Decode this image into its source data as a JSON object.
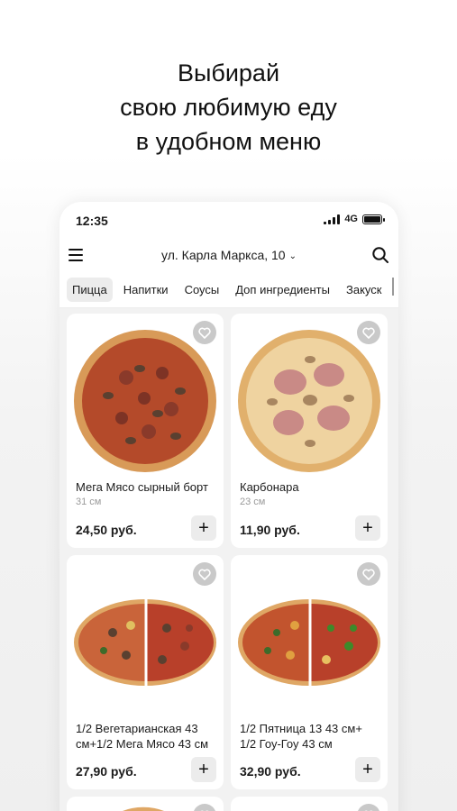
{
  "promo": {
    "line1": "Выбирай",
    "line2": "свою любимую еду",
    "line3": "в удобном меню"
  },
  "status_bar": {
    "time": "12:35",
    "network": "4G",
    "icons": [
      "signal-icon",
      "battery-icon"
    ]
  },
  "header": {
    "address": "ул. Карла Маркса, 10",
    "address_chevron": "⌄",
    "icons": [
      "menu-icon",
      "search-icon"
    ]
  },
  "tabs": [
    {
      "label": "Пицца",
      "active": true
    },
    {
      "label": "Напитки",
      "active": false
    },
    {
      "label": "Соусы",
      "active": false
    },
    {
      "label": "Доп ингредиенты",
      "active": false
    },
    {
      "label": "Закуск",
      "active": false
    }
  ],
  "products": [
    {
      "name": "Мега Мясо сырный борт",
      "size": "31 см",
      "price": "24,50 руб.",
      "add_label": "+"
    },
    {
      "name": "Карбонара",
      "size": "23 см",
      "price": "11,90 руб.",
      "add_label": "+"
    },
    {
      "name": "1/2 Вегетарианская 43 см+1/2 Мега Мясо 43 см",
      "size": "",
      "price": "27,90 руб.",
      "add_label": "+"
    },
    {
      "name": "1/2 Пятница 13 43 см+ 1/2 Гоу-Гоу 43 см",
      "size": "",
      "price": "32,90 руб.",
      "add_label": "+"
    }
  ],
  "colors": {
    "accent_bg": "#ececec",
    "fav_bg": "#c9c9c9",
    "muted_text": "#9a9a9a"
  }
}
